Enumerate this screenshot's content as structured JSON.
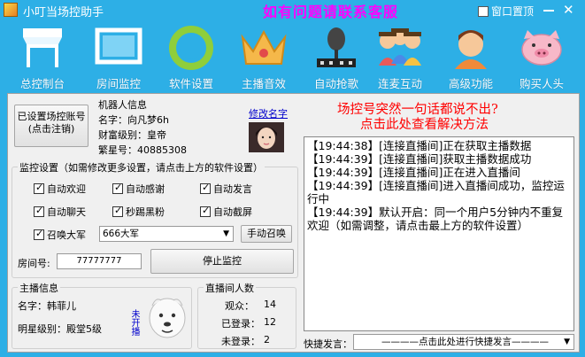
{
  "window": {
    "title": "小叮当场控助手",
    "banner": "如有问题请联系客服",
    "topmost_label": "窗口置顶"
  },
  "toolbar": [
    {
      "label": "总控制台",
      "icon": "storefront-icon"
    },
    {
      "label": "房间监控",
      "icon": "monitor-screen-icon"
    },
    {
      "label": "软件设置",
      "icon": "gear-ring-icon"
    },
    {
      "label": "主播音效",
      "icon": "crown-icon"
    },
    {
      "label": "自动抢歌",
      "icon": "microphone-mixer-icon"
    },
    {
      "label": "连麦互动",
      "icon": "group-people-icon"
    },
    {
      "label": "高级功能",
      "icon": "person-avatar-icon"
    },
    {
      "label": "购买人头",
      "icon": "pig-icon"
    }
  ],
  "account": {
    "button_label": "已设置场控账号\n(点击注销)"
  },
  "robot": {
    "group_title": "机器人信息",
    "name_label": "名字：向凡梦6h",
    "wealth_label": "财富级别：皇帝",
    "fan_label": "繁星号：40885308",
    "rename_link": "修改名字"
  },
  "promo": {
    "line1": "场控号突然一句话都说不出?",
    "line2": "点击此处查看解决方法"
  },
  "monitor": {
    "group_title": "监控设置（如需修改更多设置，请点击上方的软件设置）",
    "checkboxes": [
      "自动欢迎",
      "自动感谢",
      "自动发言",
      "自动聊天",
      "秒踢黑粉",
      "自动截屏",
      "召唤大军"
    ],
    "army_select": "666大军",
    "summon_button": "手动召唤",
    "room_label": "房间号:",
    "room_value": "77777777",
    "stop_button": "停止监控"
  },
  "host": {
    "group_title": "主播信息",
    "name_label": "名字：韩菲儿",
    "level_label": "明星级别：殿堂5级",
    "not_open": "未开播"
  },
  "stats": {
    "group_title": "直播间人数",
    "watching_label": "观众：",
    "watching_value": "14",
    "logged_label": "已登录：",
    "logged_value": "12",
    "guest_label": "未登录：",
    "guest_value": "2"
  },
  "log": [
    "【19:44:38】[连接直播间]正在获取主播数据",
    "【19:44:39】[连接直播间]获取主播数据成功",
    "【19:44:39】[连接直播间]正在进入直播间",
    "【19:44:39】[连接直播间]进入直播间成功，监控运行中",
    "【19:44:39】默认开启：同一个用户5分钟内不重复欢迎（如需调整，请点击最上方的软件设置）"
  ],
  "quick": {
    "label": "快捷发言：",
    "select": "————点击此处进行快捷发言————"
  }
}
